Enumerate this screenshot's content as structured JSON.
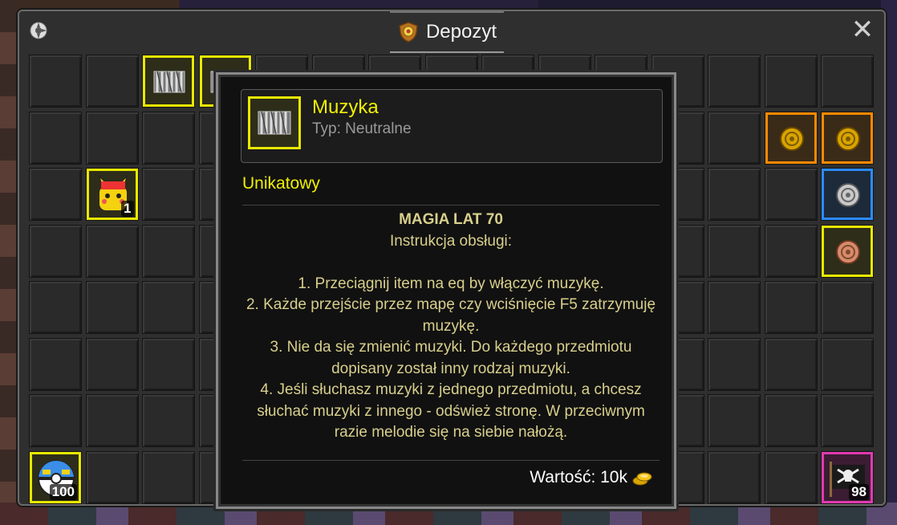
{
  "window": {
    "title": "Depozyt"
  },
  "grid": {
    "columns": 15,
    "rows": 8,
    "items": [
      {
        "col": 2,
        "row": 0,
        "kind": "accordion-icon",
        "rarity": "yellow"
      },
      {
        "col": 3,
        "row": 0,
        "kind": "accordion-icon",
        "rarity": "yellow"
      },
      {
        "col": 1,
        "row": 2,
        "kind": "pikachu-icon",
        "rarity": "yellow",
        "count": "1"
      },
      {
        "col": 13,
        "row": 1,
        "kind": "gold-coin-icon",
        "rarity": "orange"
      },
      {
        "col": 14,
        "row": 1,
        "kind": "gold-coin-icon",
        "rarity": "orange"
      },
      {
        "col": 14,
        "row": 2,
        "kind": "silver-coin-icon",
        "rarity": "blue"
      },
      {
        "col": 14,
        "row": 3,
        "kind": "copper-coin-icon",
        "rarity": "yellow"
      },
      {
        "col": 0,
        "row": 7,
        "kind": "pokeball-icon",
        "rarity": "yellow",
        "count": "100"
      },
      {
        "col": 14,
        "row": 7,
        "kind": "pirate-flag-icon",
        "rarity": "pink",
        "count": "98"
      }
    ]
  },
  "tooltip": {
    "name": "Muzyka",
    "type": "Typ: Neutralne",
    "rarity": "Unikatowy",
    "heading": "MAGIA LAT 70",
    "subheading": "Instrukcja obsługi:",
    "steps": [
      "1. Przeciągnij item na eq by włączyć muzykę.",
      "2. Każde przejście przez mapę czy wciśnięcie F5 zatrzymuję muzykę.",
      "3. Nie da się zmienić muzyki. Do każdego przedmiotu dopisany został inny rodzaj muzyki.",
      "4. Jeśli słuchasz muzyki z jednego przedmiotu, a chcesz słuchać muzyki z innego - odśwież stronę. W przeciwnym razie melodie się na siebie nałożą."
    ],
    "value": "Wartość: 10k"
  },
  "colors": {
    "yellow": "#e8e800",
    "orange": "#ff8a00",
    "blue": "#2b8cff",
    "pink": "#e03ab0",
    "description_text": "#d8cf8c"
  }
}
